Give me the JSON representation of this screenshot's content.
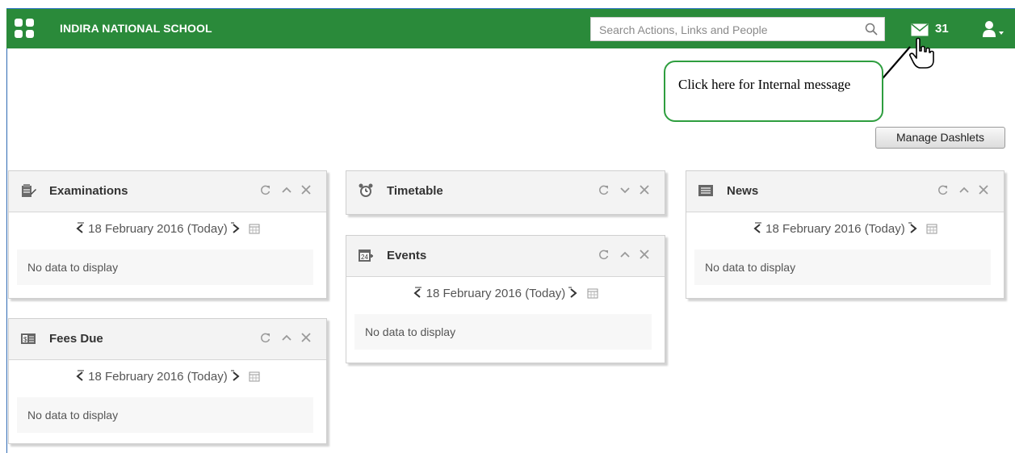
{
  "header": {
    "school_name": "INDIRA NATIONAL SCHOOL",
    "search_placeholder": "Search Actions, Links and People",
    "message_count": "31",
    "brand_color": "#2a8a3a"
  },
  "callout": {
    "text": "Click here for Internal message"
  },
  "toolbar": {
    "manage_dashlets_label": "Manage Dashlets"
  },
  "dashlets": {
    "examinations": {
      "title": "Examinations",
      "icon": "exam-icon",
      "date": "18 February 2016 (Today)",
      "empty": "No data to display"
    },
    "fees_due": {
      "title": "Fees Due",
      "icon": "fees-icon",
      "date": "18 February 2016 (Today)",
      "empty": "No data to display"
    },
    "timetable": {
      "title": "Timetable",
      "icon": "alarm-clock-icon",
      "collapsed": true
    },
    "events": {
      "title": "Events",
      "icon": "calendar-add-icon",
      "date": "18 February 2016 (Today)",
      "empty": "No data to display"
    },
    "news": {
      "title": "News",
      "icon": "newspaper-icon",
      "date": "18 February 2016 (Today)",
      "empty": "No data to display"
    }
  }
}
